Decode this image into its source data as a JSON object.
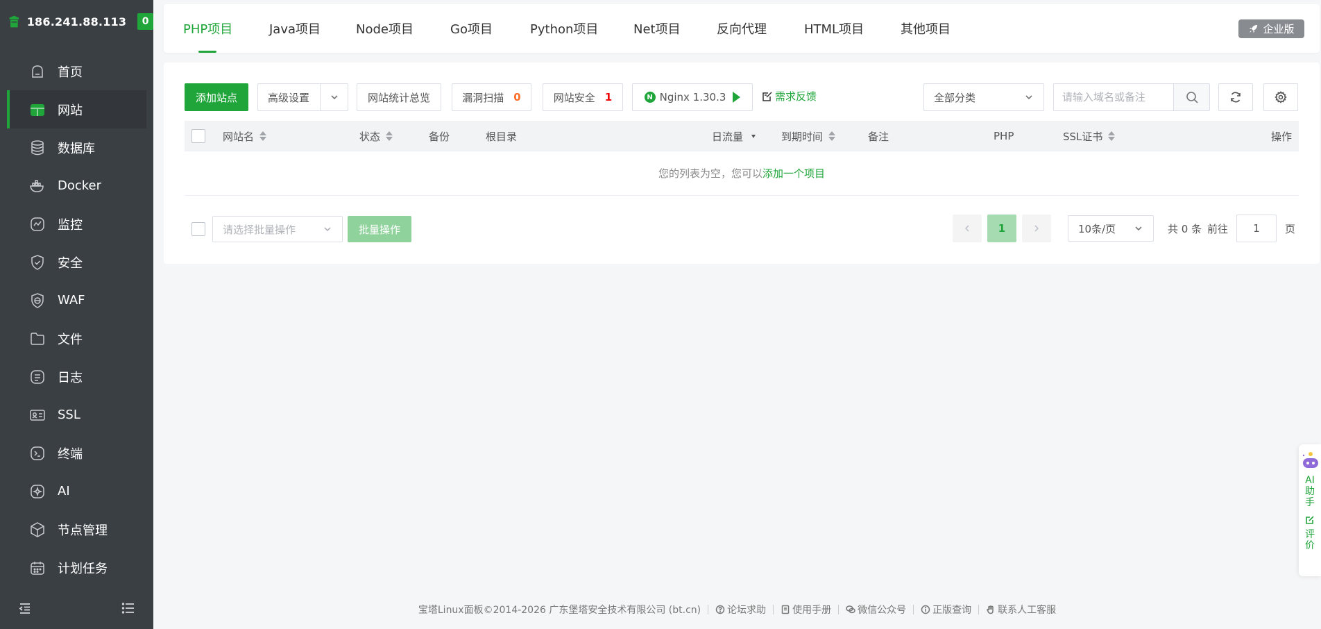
{
  "sidebar": {
    "ip": "186.241.88.113",
    "badge": "0",
    "items": [
      {
        "label": "首页",
        "icon": "home-icon"
      },
      {
        "label": "网站",
        "icon": "website-icon"
      },
      {
        "label": "数据库",
        "icon": "database-icon"
      },
      {
        "label": "Docker",
        "icon": "docker-icon"
      },
      {
        "label": "监控",
        "icon": "monitor-icon"
      },
      {
        "label": "安全",
        "icon": "shield-icon"
      },
      {
        "label": "WAF",
        "icon": "waf-icon"
      },
      {
        "label": "文件",
        "icon": "folder-icon"
      },
      {
        "label": "日志",
        "icon": "log-icon"
      },
      {
        "label": "SSL",
        "icon": "ssl-icon"
      },
      {
        "label": "终端",
        "icon": "terminal-icon"
      },
      {
        "label": "AI",
        "icon": "ai-icon"
      },
      {
        "label": "节点管理",
        "icon": "node-icon"
      },
      {
        "label": "计划任务",
        "icon": "calendar-icon"
      }
    ]
  },
  "tabs": [
    "PHP项目",
    "Java项目",
    "Node项目",
    "Go项目",
    "Python项目",
    "Net项目",
    "反向代理",
    "HTML项目",
    "其他项目"
  ],
  "enterprise_label": "企业版",
  "toolbar": {
    "add_site": "添加站点",
    "advanced": "高级设置",
    "stats": "网站统计总览",
    "vuln_scan": "漏洞扫描",
    "vuln_count": "0",
    "site_security": "网站安全",
    "security_count": "1",
    "nginx": "Nginx 1.30.3",
    "feedback": "需求反馈",
    "category": "全部分类",
    "search_placeholder": "请输入域名或备注"
  },
  "table": {
    "headers": {
      "name": "网站名",
      "status": "状态",
      "backup": "备份",
      "root": "根目录",
      "traffic": "日流量",
      "expire": "到期时间",
      "remark": "备注",
      "php": "PHP",
      "ssl": "SSL证书",
      "action": "操作"
    },
    "empty_text": "您的列表为空，您可以",
    "empty_link": "添加一个项目"
  },
  "bottom": {
    "batch_placeholder": "请选择批量操作",
    "batch_button": "批量操作",
    "current_page": "1",
    "page_size": "10条/页",
    "total": "共 0 条",
    "goto_label": "前往",
    "goto_value": "1",
    "page_suffix": "页"
  },
  "footer": {
    "copyright": "宝塔Linux面板©2014-2026 广东堡塔安全技术有限公司 (bt.cn)",
    "links": [
      "论坛求助",
      "使用手册",
      "微信公众号",
      "正版查询",
      "联系人工客服"
    ]
  },
  "ai_float": {
    "assistant": "AI助手",
    "rate": "评价"
  },
  "colors": {
    "accent": "#20a53a",
    "sidebar_bg": "#3a3f44",
    "warning": "#fc6d26",
    "danger": "#ef0808"
  }
}
